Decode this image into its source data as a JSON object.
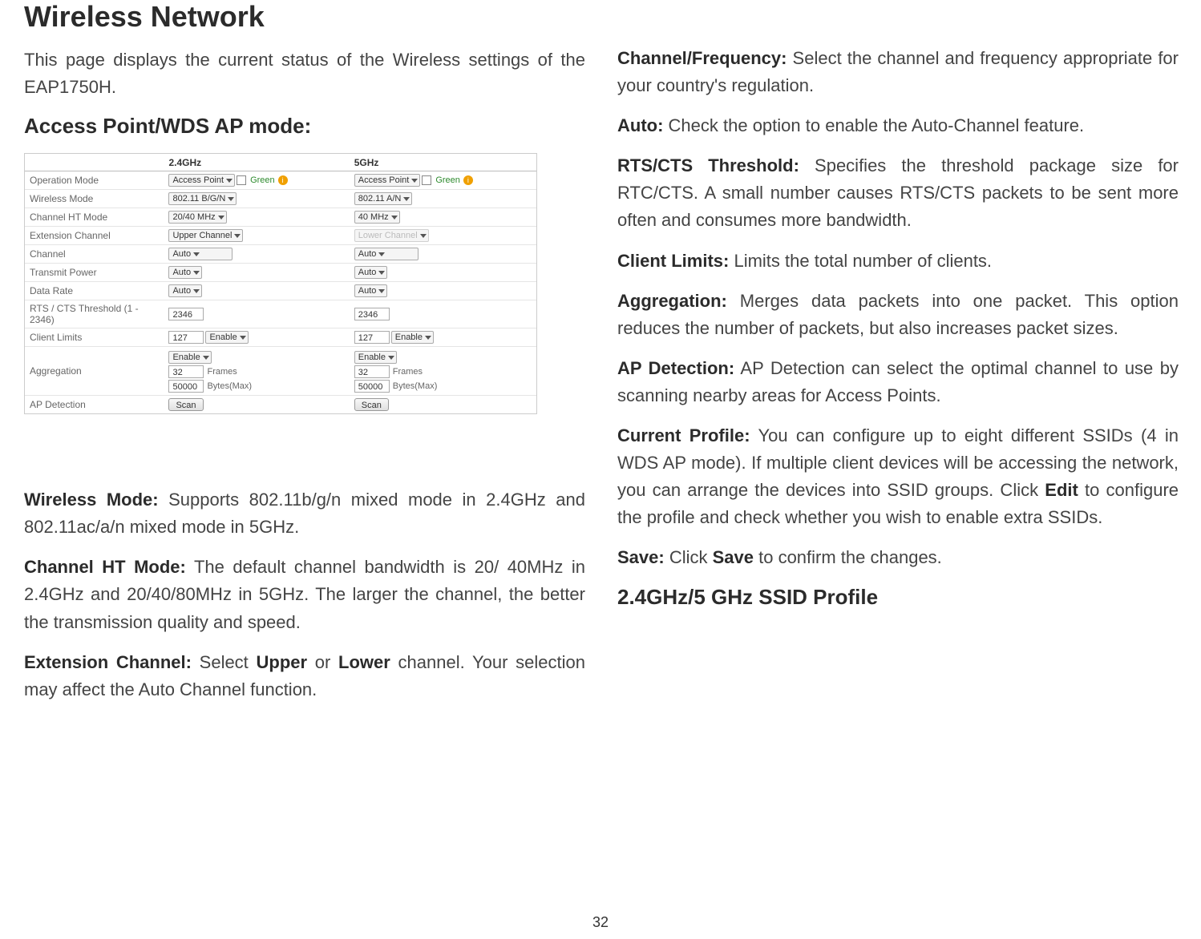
{
  "title": "Wireless Network",
  "intro": "This page displays the current status of the Wireless settings of the EAP1750H.",
  "section_ap_mode": "Access Point/WDS AP mode:",
  "table": {
    "headers": {
      "col1": "2.4GHz",
      "col2": "5GHz"
    },
    "rows": {
      "op_mode": {
        "label": "Operation Mode",
        "a": "Access Point",
        "b": "Access Point",
        "green": "Green"
      },
      "wmode": {
        "label": "Wireless Mode",
        "a": "802.11 B/G/N",
        "b": "802.11 A/N"
      },
      "ht": {
        "label": "Channel HT Mode",
        "a": "20/40 MHz",
        "b": "40 MHz"
      },
      "ext": {
        "label": "Extension Channel",
        "a": "Upper Channel",
        "b": "Lower Channel"
      },
      "chan": {
        "label": "Channel",
        "a": "Auto",
        "b": "Auto"
      },
      "tx": {
        "label": "Transmit Power",
        "a": "Auto",
        "b": "Auto"
      },
      "dr": {
        "label": "Data Rate",
        "a": "Auto",
        "b": "Auto"
      },
      "rts": {
        "label": "RTS / CTS Threshold (1 - 2346)",
        "a": "2346",
        "b": "2346"
      },
      "cl": {
        "label": "Client Limits",
        "a_val": "127",
        "a_sel": "Enable",
        "b_val": "127",
        "b_sel": "Enable"
      },
      "agg": {
        "label": "Aggregation",
        "sel": "Enable",
        "frames_val": "32",
        "frames_lbl": "Frames",
        "bytes_val": "50000",
        "bytes_lbl": "Bytes(Max)"
      },
      "apd": {
        "label": "AP Detection",
        "btn": "Scan"
      }
    }
  },
  "paragraphs": {
    "wmode": {
      "bold": "Wireless Mode:",
      "text": " Supports 802.11b/g/n mixed mode in 2.4GHz and 802.11ac/a/n mixed mode in 5GHz."
    },
    "htmode": {
      "bold": "Channel HT Mode:",
      "text": " The default channel bandwidth is 20/ 40MHz in 2.4GHz and 20/40/80MHz in 5GHz. The larger the channel, the better the transmission quality and speed."
    },
    "ext": {
      "bold": "Extension Channel:",
      "text_a": " Select ",
      "upper": "Upper",
      "or": " or ",
      "lower": "Lower",
      "text_b": " channel. Your selection may affect the Auto Channel function."
    },
    "chfreq": {
      "bold": "Channel/Frequency:",
      "text": " Select the channel and frequency appropriate for your country's regulation."
    },
    "auto": {
      "bold": "Auto:",
      "text": " Check the option to enable the Auto-Channel feature."
    },
    "rts": {
      "bold": "RTS/CTS Threshold:",
      "text": " Specifies the threshold package size for RTC/CTS. A small number causes RTS/CTS packets to be sent more often and consumes more bandwidth."
    },
    "cl": {
      "bold": "Client Limits:",
      "text": " Limits the total number of clients."
    },
    "agg": {
      "bold": "Aggregation:",
      "text": " Merges data packets into one packet. This option reduces the number of packets, but also increases packet sizes."
    },
    "apd": {
      "bold": "AP Detection:",
      "text": " AP Detection can select the optimal channel to use by scanning nearby areas for Access Points."
    },
    "cprof": {
      "bold": "Current Profile:",
      "text_a": " You can configure up to eight different SSIDs (4 in WDS AP mode). If multiple client devices will be accessing the network, you can arrange the devices into SSID groups. Click ",
      "edit": "Edit",
      "text_b": " to configure the profile and check whether you  wish to enable extra SSIDs."
    },
    "save": {
      "bold": "Save:",
      "text_a": " Click ",
      "save_b": "Save",
      "text_b": " to confirm the changes."
    }
  },
  "section_ssid": "2.4GHz/5 GHz SSID Profile",
  "page_number": "32"
}
